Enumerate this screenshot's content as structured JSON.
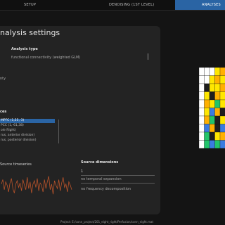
{
  "tabs": [
    {
      "label": "SETUP",
      "active": false
    },
    {
      "label": "DENOISING (1st level)",
      "active": false
    },
    {
      "label": "ANALYSES",
      "active": true
    }
  ],
  "panel": {
    "title": "nalysis settings",
    "analysis_type_label": "Analysis type",
    "analysis_type_value": "functional connectivity (weighted GLM)",
    "side_text": "nty",
    "sources_label": "ces",
    "sources": [
      "MPFC (1,55,-3)",
      "PCC (1,-61,38)",
      "ole Right)",
      "rus, anterior division)",
      "rus, posterior division)"
    ],
    "timeseries_label": "Source timeseries",
    "source_dimensions_label": "Source dimensions",
    "source_dimensions_value": "1",
    "temporal_expansion": "no temporal expansion",
    "frequency_decomposition": "no frequency decomposition"
  },
  "colors": {
    "accent": "#2a64a4",
    "panel_bg": "#232323",
    "timeseries_line": "#b8532a"
  },
  "footer": "Project: E:/conn_project/201_eight_right/Perfusion/conn_eight.mat",
  "timeseries": [
    0.2,
    0.6,
    -0.3,
    0.4,
    0.1,
    -0.5,
    0.3,
    0.7,
    -0.2,
    -0.6,
    0.2,
    0.5,
    -0.1,
    0.3,
    -0.4,
    0.6,
    0.1,
    -0.3,
    0.8,
    -0.2,
    0.4,
    -0.6,
    0.2,
    0.5,
    -0.1,
    0.7,
    -0.4,
    0.3,
    0.1,
    -0.5,
    0.6,
    -0.2,
    0.4,
    0.9,
    -0.3,
    0.2,
    -0.7,
    0.5,
    0.1,
    -0.2,
    0.6,
    -0.4,
    0.3,
    0.8,
    -0.1,
    0.2,
    -0.5,
    0.4,
    0.1,
    -0.3
  ],
  "heatmap": [
    [
      0,
      0,
      0,
      1,
      2
    ],
    [
      0,
      0,
      1,
      2,
      1
    ],
    [
      0,
      3,
      1,
      1,
      2
    ],
    [
      0,
      1,
      3,
      2,
      1
    ],
    [
      0,
      2,
      1,
      5,
      1
    ],
    [
      0,
      1,
      4,
      2,
      3
    ],
    [
      0,
      2,
      5,
      3,
      1
    ],
    [
      0,
      4,
      2,
      3,
      4
    ],
    [
      0,
      5,
      3,
      1,
      2
    ],
    [
      0,
      5,
      4,
      5,
      4
    ]
  ],
  "heatmap_palette": [
    "#ffffff",
    "#ffe600",
    "#ffb000",
    "#1e1e1e",
    "#3a7be0",
    "#22c46a"
  ],
  "colorbar_stops": [
    "#ff3b00",
    "#ffb000",
    "#ffe600",
    "#88d04a",
    "#22c4a0",
    "#3a7be0"
  ]
}
